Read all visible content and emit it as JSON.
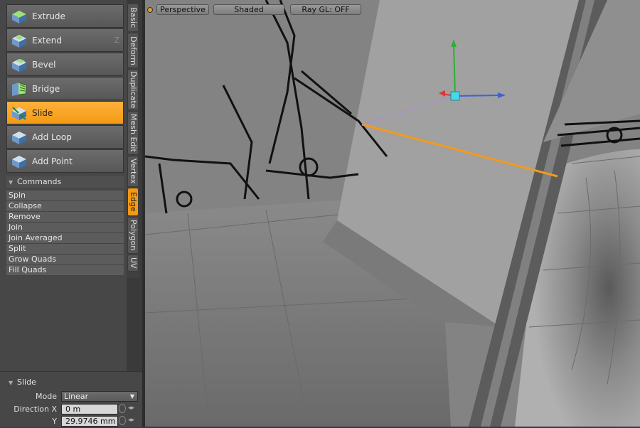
{
  "tools": [
    {
      "label": "Extrude",
      "hotkey": "",
      "icon": "extrude-icon"
    },
    {
      "label": "Extend",
      "hotkey": "Z",
      "icon": "extend-icon"
    },
    {
      "label": "Bevel",
      "hotkey": "",
      "icon": "bevel-icon"
    },
    {
      "label": "Bridge",
      "hotkey": "",
      "icon": "bridge-icon"
    },
    {
      "label": "Slide",
      "hotkey": "",
      "icon": "slide-icon",
      "active": true
    },
    {
      "label": "Add Loop",
      "hotkey": "",
      "icon": "add-loop-icon"
    },
    {
      "label": "Add Point",
      "hotkey": "",
      "icon": "add-point-icon"
    }
  ],
  "commands": {
    "header": "Commands",
    "items": [
      "Spin",
      "Collapse",
      "Remove",
      "Join",
      "Join Averaged",
      "Split",
      "Grow Quads",
      "Fill Quads"
    ]
  },
  "tabs": [
    "Basic",
    "Deform",
    "Duplicate",
    "Mesh Edit",
    "Vertex",
    "Edge",
    "Polygon",
    "UV"
  ],
  "active_tab": "Edge",
  "properties": {
    "header": "Slide",
    "mode_label": "Mode",
    "mode_value": "Linear",
    "direction_x_label": "Direction X",
    "direction_x_value": "0 m",
    "y_label": "Y",
    "y_value": "29.9746 mm"
  },
  "viewport": {
    "view_label": "Perspective",
    "shading_label": "Shaded",
    "raygl_label": "Ray GL: OFF"
  },
  "colors": {
    "accent": "#f39a14",
    "selected_edge": "#f29a1e",
    "gizmo_x": "#d83a3a",
    "gizmo_y": "#2fae3a",
    "gizmo_z": "#3a63d8",
    "gizmo_center": "#49d8e8"
  }
}
